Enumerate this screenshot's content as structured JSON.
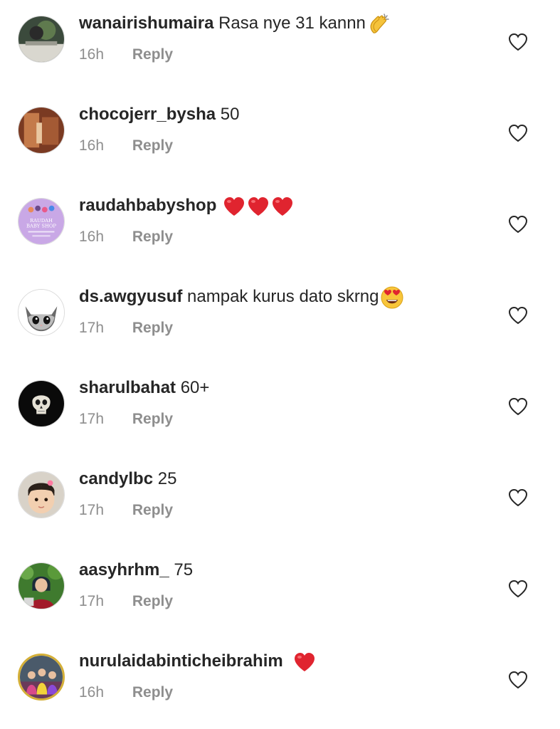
{
  "comments": [
    {
      "username": "wanairishumaira",
      "text": "Rasa nye 31 kannn",
      "emoji": "clapping-hands",
      "time": "16h",
      "reply_label": "Reply"
    },
    {
      "username": "chocojerr_bysha",
      "text": "50",
      "emoji": "",
      "time": "16h",
      "reply_label": "Reply"
    },
    {
      "username": "raudahbabyshop",
      "text": "",
      "emoji": "red-heart x3",
      "time": "16h",
      "reply_label": "Reply",
      "avatar_logo_text": "RAUDAH BABY SHOP"
    },
    {
      "username": "ds.awgyusuf",
      "text": "nampak kurus dato skrng",
      "emoji": "heart-eyes",
      "time": "17h",
      "reply_label": "Reply"
    },
    {
      "username": "sharulbahat",
      "text": "60+",
      "emoji": "",
      "time": "17h",
      "reply_label": "Reply"
    },
    {
      "username": "candylbc",
      "text": "25",
      "emoji": "",
      "time": "17h",
      "reply_label": "Reply"
    },
    {
      "username": "aasyhrhm_",
      "text": "75",
      "emoji": "",
      "time": "17h",
      "reply_label": "Reply"
    },
    {
      "username": "nurulaidabinticheibrahim",
      "text": "",
      "emoji": "red-heart",
      "time": "16h",
      "reply_label": "Reply"
    }
  ],
  "icons": {
    "like": "heart-outline-icon"
  },
  "colors": {
    "text": "#262626",
    "secondary": "#8e8e8e",
    "heart_red": "#e0242f"
  }
}
